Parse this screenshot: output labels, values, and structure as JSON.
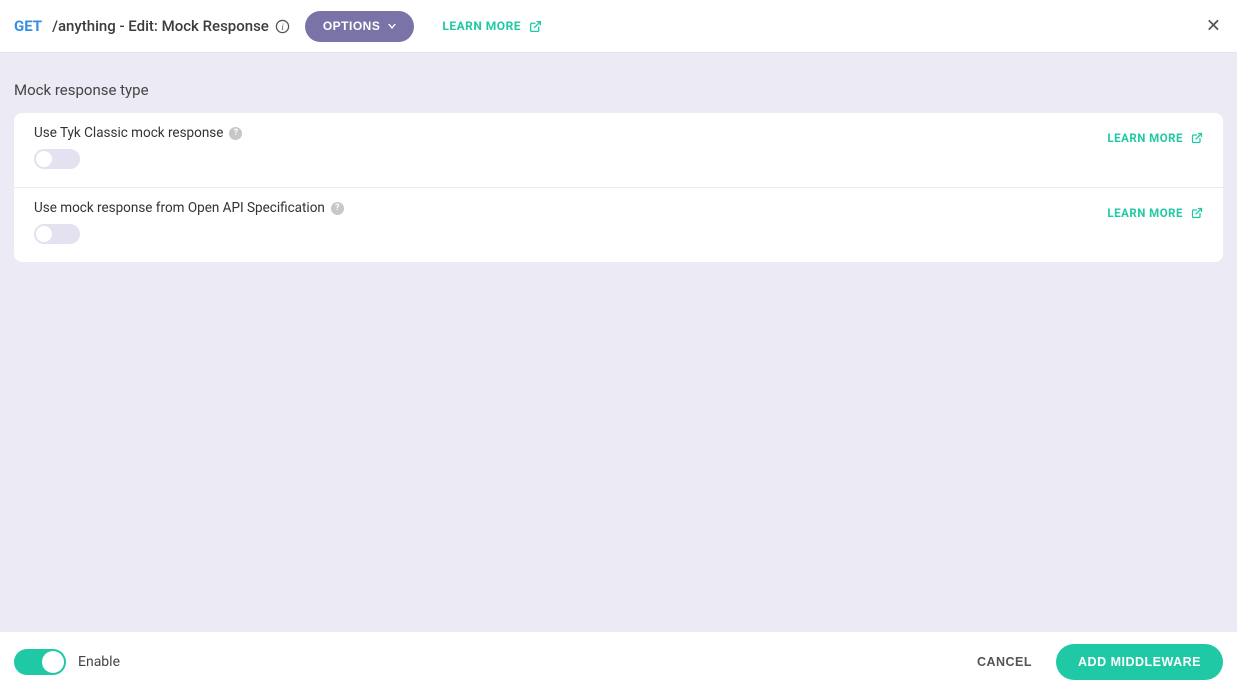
{
  "header": {
    "method": "GET",
    "path_title": "/anything - Edit: Mock Response",
    "options_label": "OPTIONS",
    "learn_more": "LEARN MORE"
  },
  "section": {
    "title": "Mock response type",
    "rows": [
      {
        "label": "Use Tyk Classic mock response",
        "learn_more": "LEARN MORE",
        "enabled": false
      },
      {
        "label": "Use mock response from Open API Specification",
        "learn_more": "LEARN MORE",
        "enabled": false
      }
    ]
  },
  "footer": {
    "enable_label": "Enable",
    "enable_value": true,
    "cancel": "CANCEL",
    "primary": "ADD MIDDLEWARE"
  },
  "colors": {
    "accent": "#1fc9a5",
    "muted_purple": "#7a73a8",
    "bg_lavender": "#ebeaf5"
  }
}
